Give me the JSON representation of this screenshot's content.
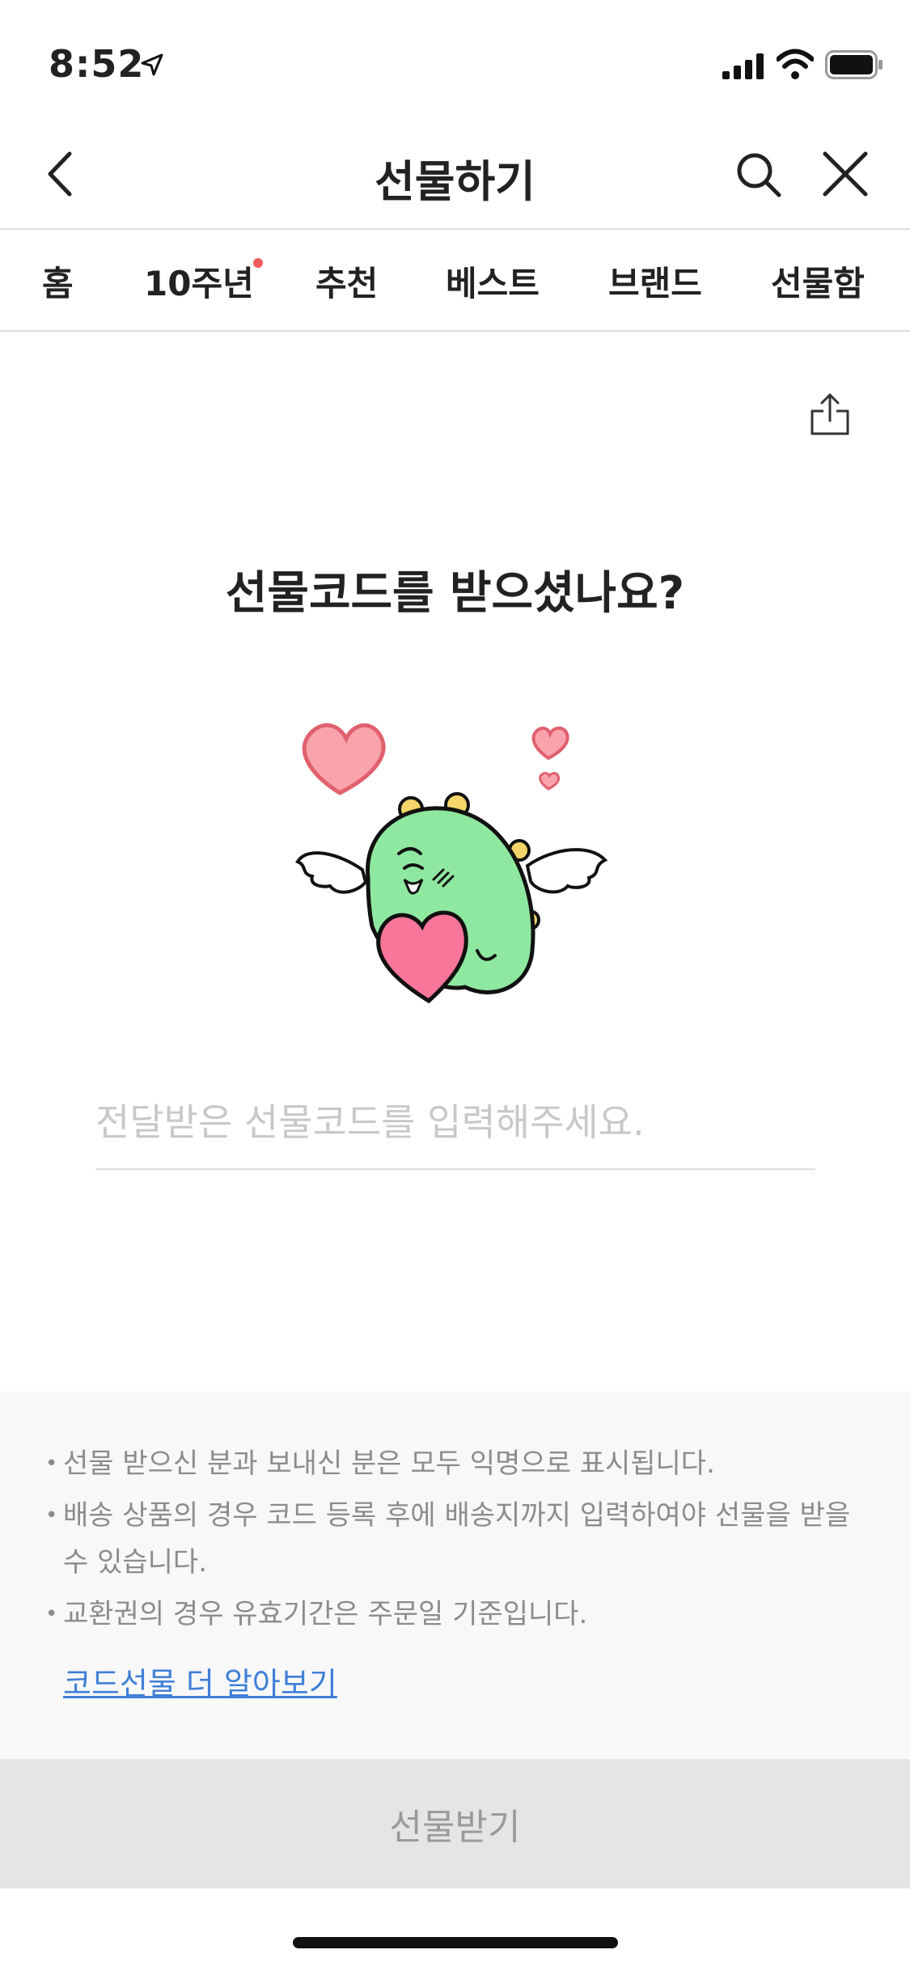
{
  "status_bar": {
    "time": "8:52",
    "icons": [
      "location-arrow-icon",
      "signal-bars-icon",
      "wifi-icon",
      "battery-icon"
    ]
  },
  "header": {
    "title": "선물하기",
    "icons": [
      "chevron-left-icon",
      "search-icon",
      "close-icon"
    ]
  },
  "tabs": [
    {
      "label": "홈"
    },
    {
      "label": "10주년",
      "has_badge_dot": true
    },
    {
      "label": "추천"
    },
    {
      "label": "베스트"
    },
    {
      "label": "브랜드"
    },
    {
      "label": "선물함"
    }
  ],
  "main": {
    "heading": "선물코드를 받으셨나요?",
    "share_icon": "share-icon",
    "illustration": "winged-green-dinosaur-with-hearts",
    "code_input": {
      "value": "",
      "placeholder": "전달받은 선물코드를 입력해주세요."
    }
  },
  "notices": {
    "items": [
      "선물 받으신 분과 보내신 분은 모두 익명으로 표시됩니다.",
      "배송 상품의 경우 코드 등록 후에 배송지까지 입력하여야 선물을 받을 수 있습니다.",
      "교환권의 경우 유효기간은 주문일 기준입니다."
    ],
    "link_label": "코드선물 더 알아보기"
  },
  "footer": {
    "button_label": "선물받기"
  },
  "colors": {
    "badge_dot": "#f35b5b",
    "link": "#3f7fd8",
    "button_disabled_bg": "#e5e5e5",
    "mascot_green": "#8fe8a0",
    "heart_pink": "#f7769a"
  }
}
